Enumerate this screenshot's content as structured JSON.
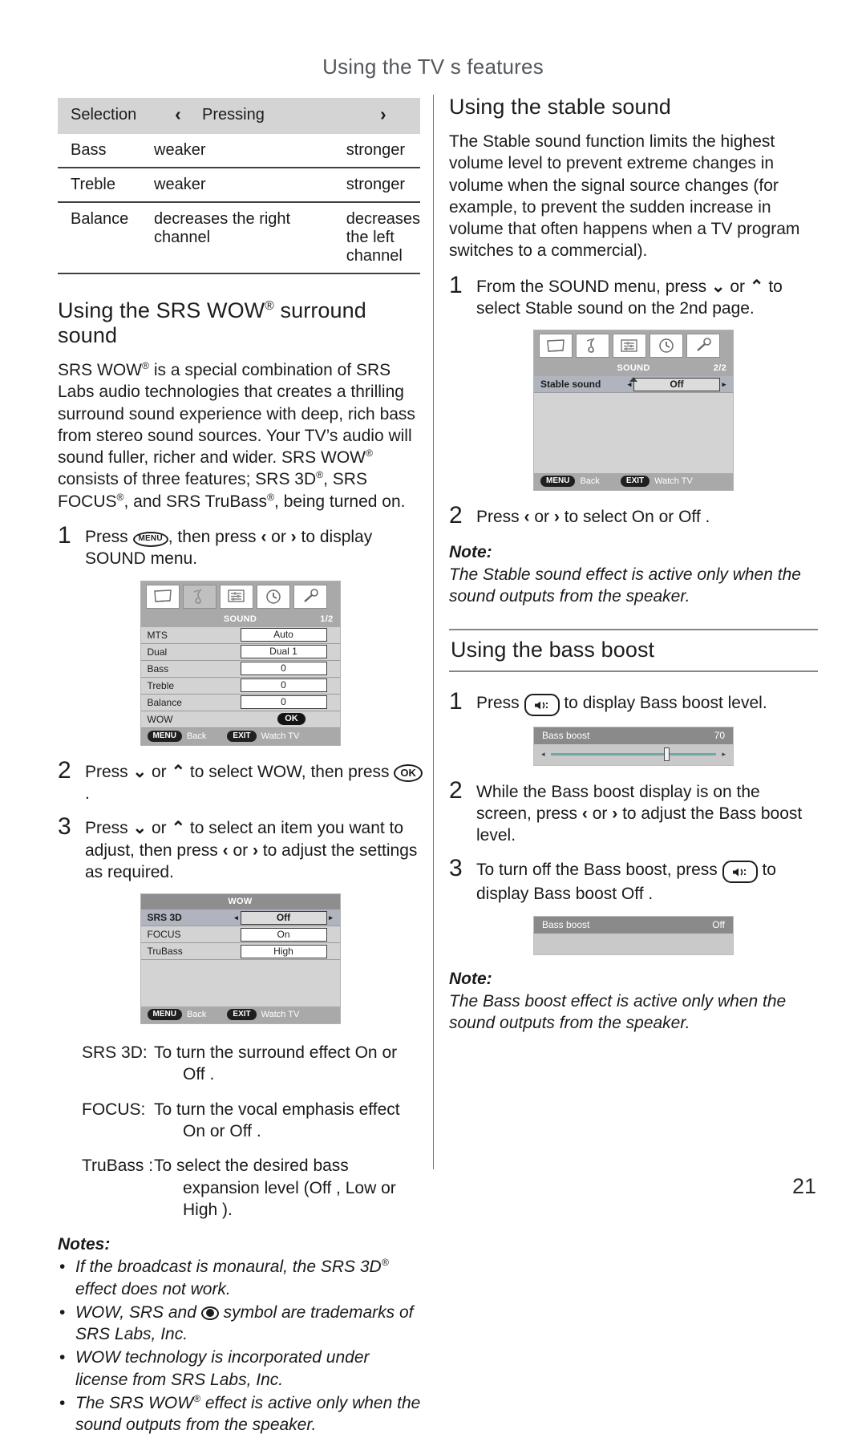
{
  "page": {
    "header": "Using the TV s features",
    "number": "21"
  },
  "table": {
    "headers": {
      "selection": "Selection",
      "left_arrow": "‹",
      "pressing": "Pressing",
      "right_arrow": "›"
    },
    "rows": [
      {
        "selection": "Bass",
        "left": "weaker",
        "right": "stronger"
      },
      {
        "selection": "Treble",
        "left": "weaker",
        "right": "stronger"
      },
      {
        "selection": "Balance",
        "left": "decreases the right channel",
        "right": "decreases the left channel"
      }
    ]
  },
  "srs_section": {
    "heading_pre": "Using the SRS WOW",
    "heading_post": " surround sound",
    "intro": "is a special combination of SRS Labs audio technologies that creates a thrilling surround sound experience with deep, rich bass from stereo sound sources. Your TV’s audio will sound fuller, richer and wider. SRS WOW",
    "intro_lead": "SRS WOW",
    "intro_tail": "consists of three features; SRS 3D",
    "intro_tail2": ", SRS FOCUS",
    "intro_tail3": ", and SRS TruBass",
    "intro_tail4": ", being turned on.",
    "steps": [
      {
        "num": "1",
        "pre": "Press ",
        "key": "MENU",
        "mid": ", then press ",
        "a1": "‹",
        "or": " or ",
        "a2": "›",
        "post": " to display SOUND menu."
      },
      {
        "num": "2",
        "pre": "Press ",
        "a1": "⌄",
        "or": " or ",
        "a2": "⌃",
        "mid": " to select WOW, then press ",
        "key": "OK",
        "post": "."
      },
      {
        "num": "3",
        "pre": "Press ",
        "a1": "⌄",
        "or": " or ",
        "a2": "⌃",
        "mid": " to select an item you want to adjust, then press ",
        "a3": "‹",
        "or2": " or ",
        "a4": "›",
        "post": " to adjust the settings as required."
      }
    ],
    "definitions": [
      {
        "term": "SRS 3D:",
        "line1": "To turn the surround effect On or",
        "line2": "Off ."
      },
      {
        "term": "FOCUS:",
        "line1": "To turn the vocal emphasis effect",
        "line2": "On or Off ."
      },
      {
        "term": "TruBass :",
        "line1": "To select the desired bass",
        "line2": "expansion level (Off , Low  or High )."
      }
    ],
    "notes_title": "Notes:",
    "notes": [
      "If the broadcast is monaural, the SRS 3D effect does not work.",
      "WOW, SRS and ● symbol are trademarks of SRS Labs, Inc.",
      "WOW technology is incorporated under license from SRS Labs, Inc.",
      "The SRS WOW effect is active only when the sound outputs from the speaker."
    ]
  },
  "sound_menu_1": {
    "title": "SOUND",
    "page_indicator": "1/2",
    "icons": [
      "picture-icon",
      "sound-icon",
      "feature-icon",
      "timer-icon",
      "setup-icon"
    ],
    "selected_icon_index": 1,
    "rows": [
      {
        "label": "MTS",
        "value": "Auto",
        "type": "value",
        "selected": false
      },
      {
        "label": "Dual",
        "value": "Dual 1",
        "type": "value",
        "selected": false
      },
      {
        "label": "Bass",
        "value": "0",
        "type": "value",
        "selected": false
      },
      {
        "label": "Treble",
        "value": "0",
        "type": "value",
        "selected": false
      },
      {
        "label": "Balance",
        "value": "0",
        "type": "value",
        "selected": false
      },
      {
        "label": "WOW",
        "value": "OK",
        "type": "ok",
        "selected": false
      }
    ],
    "footer": {
      "menu_key": "MENU",
      "menu_label": "Back",
      "exit_key": "EXIT",
      "exit_label": "Watch TV"
    }
  },
  "wow_menu": {
    "title": "WOW",
    "rows": [
      {
        "label": "SRS 3D",
        "value": "Off",
        "selected": true
      },
      {
        "label": "FOCUS",
        "value": "On",
        "selected": false
      },
      {
        "label": "TruBass",
        "value": "High",
        "selected": false
      }
    ],
    "footer": {
      "menu_key": "MENU",
      "menu_label": "Back",
      "exit_key": "EXIT",
      "exit_label": "Watch TV"
    }
  },
  "stable_section": {
    "heading": "Using the stable sound",
    "body": "The Stable sound function limits the highest volume level to prevent extreme changes in volume when the signal source changes (for example, to prevent the sudden increase in volume that often happens when a TV program switches to a commercial).",
    "steps": [
      {
        "num": "1",
        "pre": "From the SOUND menu, press ",
        "a1": "⌄",
        "or": " or ",
        "a2": "⌃",
        "post": " to select Stable sound  on the 2nd page."
      },
      {
        "num": "2",
        "pre": "Press ",
        "a1": "‹",
        "or": " or ",
        "a2": "›",
        "post": " to select On or Off ."
      }
    ],
    "note_title": "Note:",
    "note": "The Stable sound effect is active only when the sound outputs from the speaker."
  },
  "sound_menu_2": {
    "title": "SOUND",
    "page_indicator": "2/2",
    "icons": [
      "picture-icon",
      "sound-icon",
      "feature-icon",
      "timer-icon",
      "setup-icon"
    ],
    "selected_icon_index": 1,
    "rows": [
      {
        "label": "Stable sound",
        "value": "Off",
        "selected": true
      }
    ],
    "footer": {
      "menu_key": "MENU",
      "menu_label": "Back",
      "exit_key": "EXIT",
      "exit_label": "Watch TV"
    }
  },
  "bass_section": {
    "heading": "Using the bass boost",
    "steps": [
      {
        "num": "1",
        "pre": "Press ",
        "key": "volume-button",
        "post": " to display Bass boost  level."
      },
      {
        "num": "2",
        "pre": "While the Bass boost  display is on the screen, press ",
        "a1": "‹",
        "or": " or ",
        "a2": "›",
        "post": " to adjust the Bass boost level."
      },
      {
        "num": "3",
        "pre": "To turn off the Bass boost, press ",
        "key": "volume-button",
        "post": " to display Bass boost Off ."
      }
    ],
    "osd_level": {
      "label": "Bass boost",
      "value": "70",
      "slider_percent": 70
    },
    "osd_off": {
      "label": "Bass boost",
      "value": "Off"
    },
    "note_title": "Note:",
    "note": "The Bass boost effect is active only when the sound outputs from the speaker."
  },
  "colors": {
    "osd_header": "#a9a9a9",
    "osd_body": "#d3d3d3",
    "osd_selected_row": "#b0b4bf",
    "slider_track": "#6fa8a4",
    "table_header": "#d4d4d4",
    "header_text": "#54585c"
  }
}
